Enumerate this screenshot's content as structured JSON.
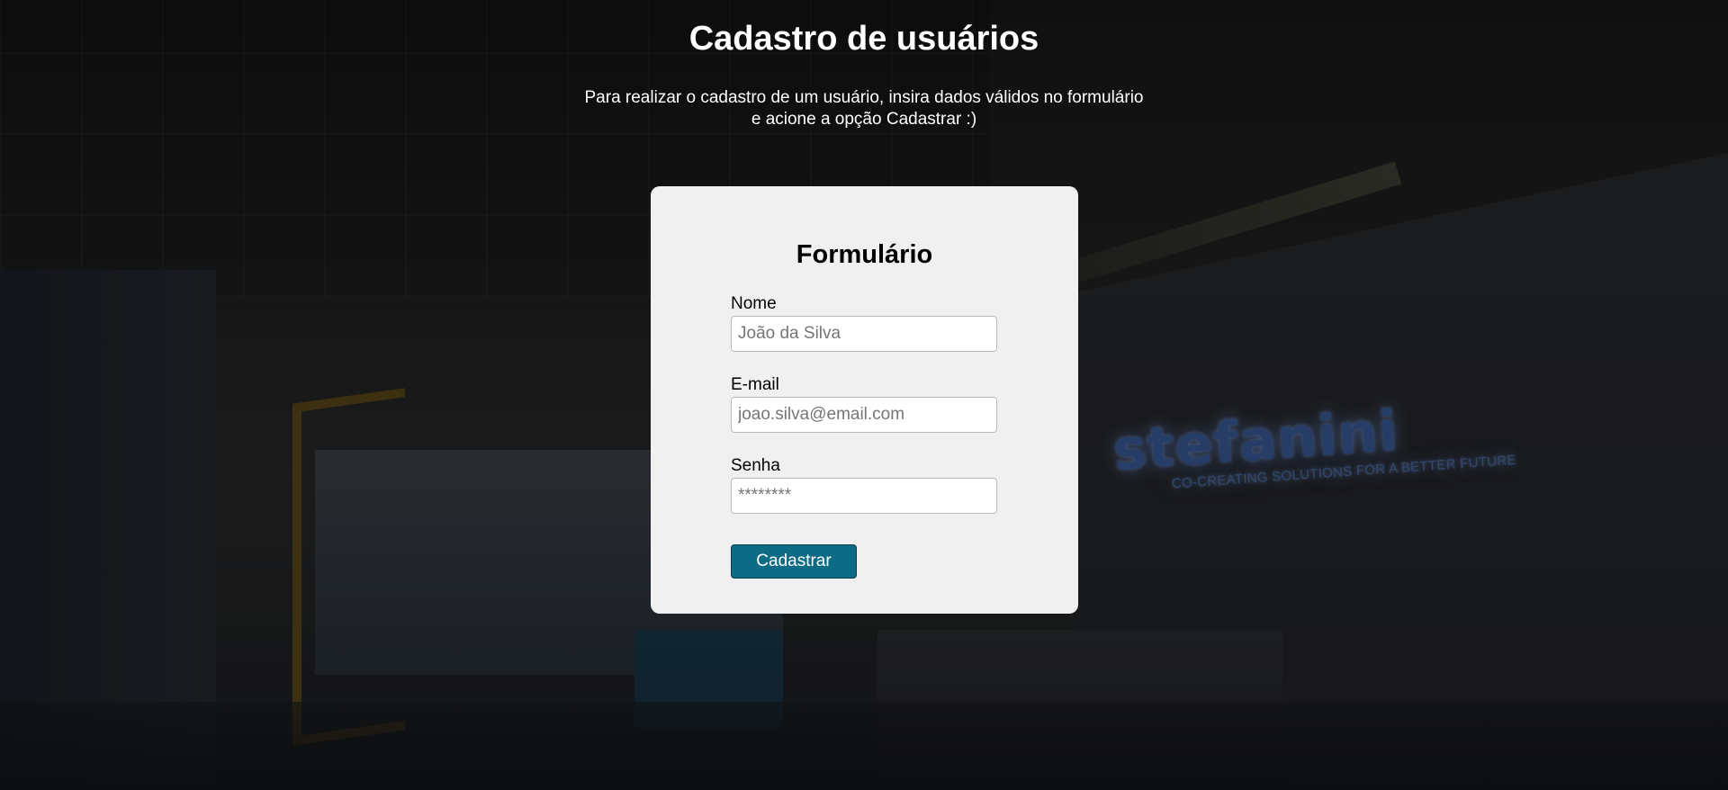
{
  "header": {
    "title": "Cadastro de usuários",
    "subtitle_line1": "Para realizar o cadastro de um usuário, insira dados válidos no formulário",
    "subtitle_line2": "e acione a opção Cadastrar :)"
  },
  "form": {
    "title": "Formulário",
    "fields": [
      {
        "label": "Nome",
        "value": "",
        "placeholder": "João da Silva",
        "type": "text"
      },
      {
        "label": "E-mail",
        "value": "",
        "placeholder": "joao.silva@email.com",
        "type": "email"
      },
      {
        "label": "Senha",
        "value": "",
        "placeholder": "********",
        "type": "password"
      }
    ],
    "submit_label": "Cadastrar"
  },
  "background": {
    "brand_logo": "stefanini",
    "brand_tagline": "CO-CREATING SOLUTIONS FOR A BETTER FUTURE"
  },
  "colors": {
    "card_bg": "#f0f0f0",
    "button_bg": "#0e6b85",
    "text_light": "#ffffff"
  }
}
